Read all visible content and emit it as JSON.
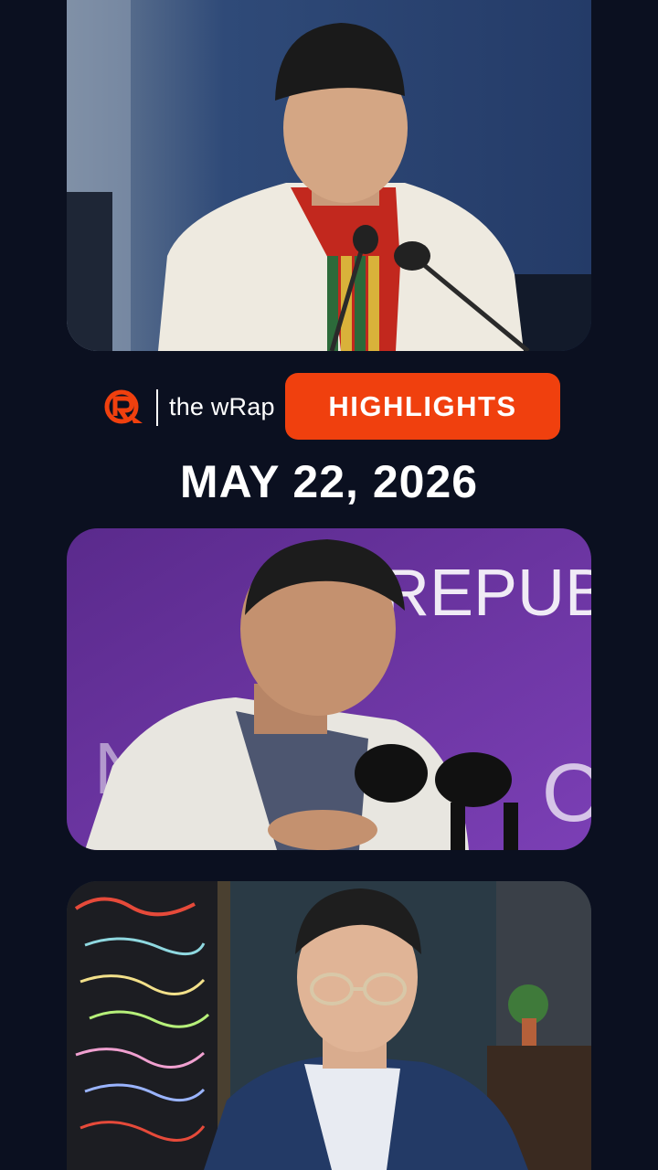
{
  "brand": {
    "logo_icon": "rappler-logo-icon",
    "name": "the wRap",
    "accent": "#f0400e"
  },
  "badge": {
    "label": "HIGHLIGHTS"
  },
  "date": "MAY 22, 2026",
  "photos": [
    {
      "icon": "news-photo-senator-speaking"
    },
    {
      "icon": "news-photo-former-president-speaking",
      "backdrop_text": "REPUB"
    },
    {
      "icon": "news-photo-interview-guest"
    }
  ],
  "colors": {
    "background": "#0b1020",
    "badge": "#f0400e",
    "text": "#ffffff"
  }
}
